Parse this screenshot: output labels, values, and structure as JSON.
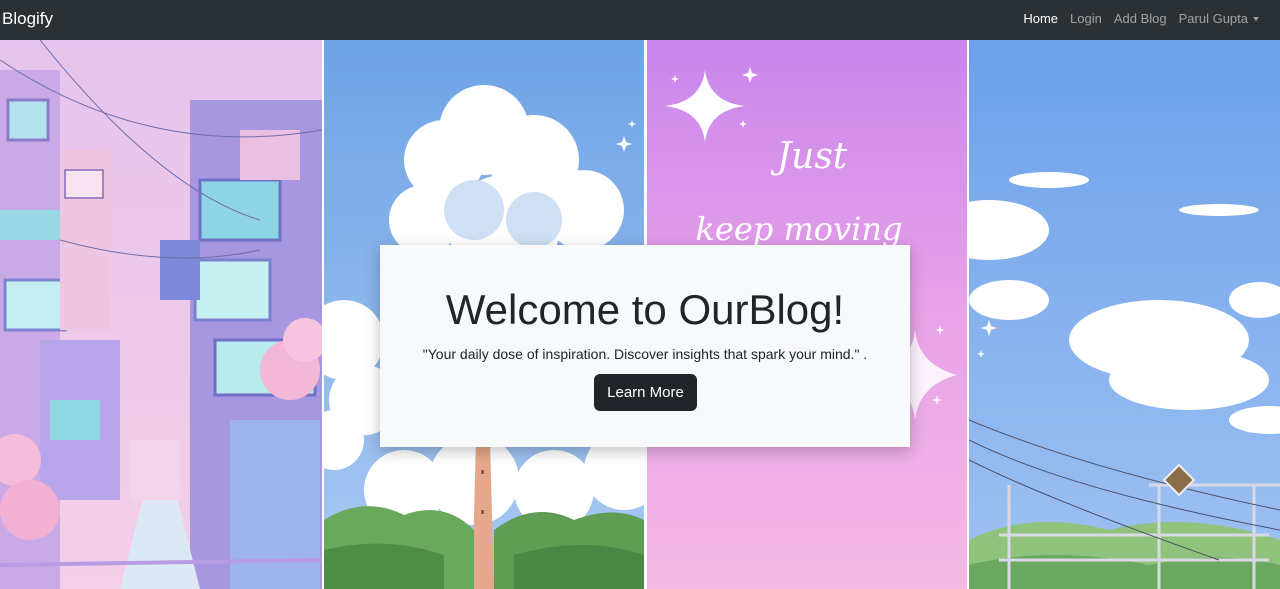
{
  "navbar": {
    "brand": "Blogify",
    "links": [
      {
        "label": "Home",
        "active": true
      },
      {
        "label": "Login",
        "active": false
      },
      {
        "label": "Add Blog",
        "active": false
      },
      {
        "label": "Parul Gupta",
        "active": false,
        "dropdown": true
      }
    ]
  },
  "gallery": {
    "panels": [
      {
        "name": "pastel-city-street",
        "text": ""
      },
      {
        "name": "clouds-lighthouse",
        "text": ""
      },
      {
        "name": "sparkle-quote",
        "text": "Just keep moving",
        "line1": "Just",
        "line2": "keep moving"
      },
      {
        "name": "sky-powerlines",
        "text": ""
      }
    ]
  },
  "hero": {
    "title": "Welcome to OurBlog!",
    "lead": "\"Your daily dose of inspiration. Discover insights that spark your mind.\" .",
    "button_label": "Learn More"
  },
  "colors": {
    "navbar_bg": "#2b3035",
    "card_bg": "#f8f9fa",
    "button_bg": "#212529"
  }
}
